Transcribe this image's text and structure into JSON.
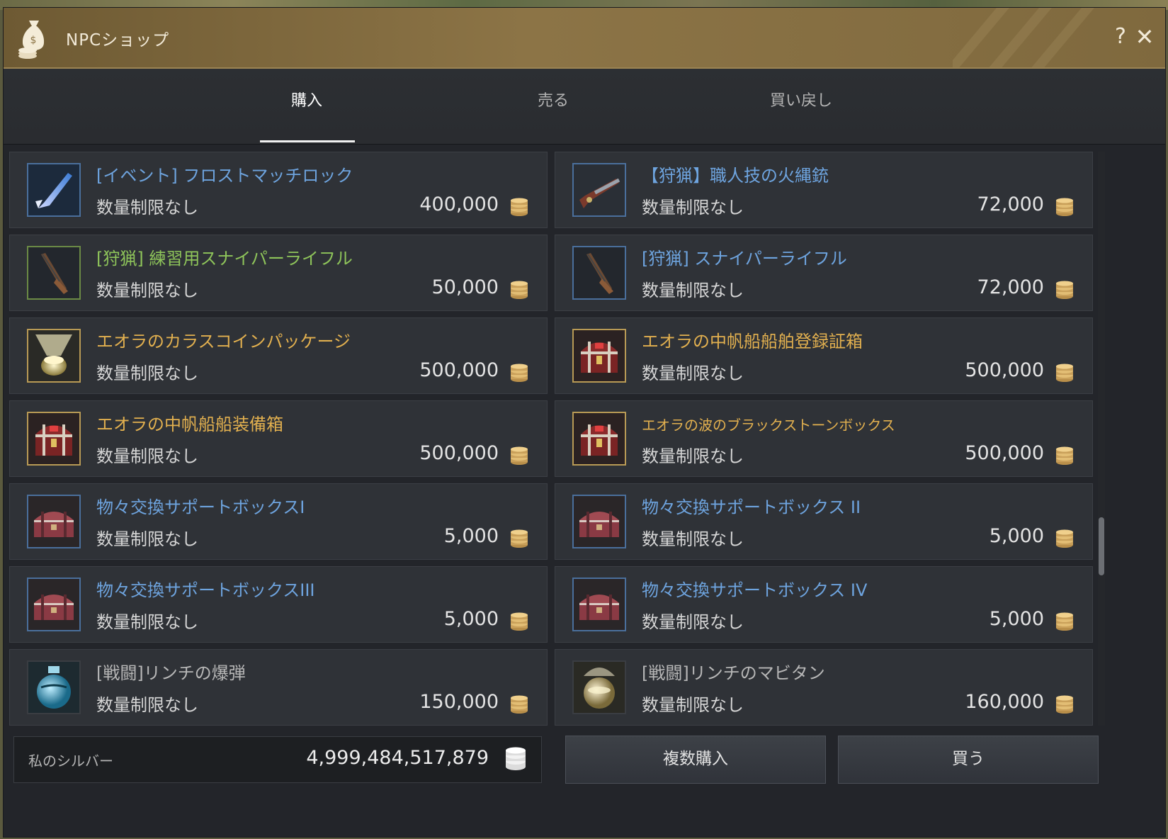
{
  "window": {
    "title": "NPCショップ",
    "help_label": "?",
    "close_label": "✕"
  },
  "tabs": [
    {
      "label": "購入",
      "active": true
    },
    {
      "label": "売る",
      "active": false
    },
    {
      "label": "買い戻し",
      "active": false
    }
  ],
  "items": [
    {
      "name": "[イベント] フロストマッチロック",
      "limit": "数量制限なし",
      "price": "400,000",
      "name_color": "blue",
      "icon": "frost-matchlock-icon"
    },
    {
      "name": "【狩猟】職人技の火縄銃",
      "limit": "数量制限なし",
      "price": "72,000",
      "name_color": "blue",
      "icon": "matchlock-gun-icon"
    },
    {
      "name": "[狩猟] 練習用スナイパーライフル",
      "limit": "数量制限なし",
      "price": "50,000",
      "name_color": "green",
      "icon": "sniper-rifle-icon"
    },
    {
      "name": "[狩猟] スナイパーライフル",
      "limit": "数量制限なし",
      "price": "72,000",
      "name_color": "blue",
      "icon": "sniper-rifle-icon"
    },
    {
      "name": "エオラのカラスコインパッケージ",
      "limit": "数量制限なし",
      "price": "500,000",
      "name_color": "gold",
      "icon": "crow-coin-package-icon"
    },
    {
      "name": "エオラの中帆船船舶登録証箱",
      "limit": "数量制限なし",
      "price": "500,000",
      "name_color": "gold",
      "icon": "treasure-chest-icon"
    },
    {
      "name": "エオラの中帆船船装備箱",
      "limit": "数量制限なし",
      "price": "500,000",
      "name_color": "gold",
      "icon": "treasure-chest-icon"
    },
    {
      "name": "エオラの波のブラックストーンボックス",
      "limit": "数量制限なし",
      "price": "500,000",
      "name_color": "gold",
      "icon": "treasure-chest-icon"
    },
    {
      "name": "物々交換サポートボックスI",
      "limit": "数量制限なし",
      "price": "5,000",
      "name_color": "blue",
      "icon": "support-box-icon"
    },
    {
      "name": "物々交換サポートボックス II",
      "limit": "数量制限なし",
      "price": "5,000",
      "name_color": "blue",
      "icon": "support-box-icon"
    },
    {
      "name": "物々交換サポートボックスIII",
      "limit": "数量制限なし",
      "price": "5,000",
      "name_color": "blue",
      "icon": "support-box-icon"
    },
    {
      "name": "物々交換サポートボックス IV",
      "limit": "数量制限なし",
      "price": "5,000",
      "name_color": "blue",
      "icon": "support-box-icon"
    },
    {
      "name": "[戦闘]リンチの爆弾",
      "limit": "数量制限なし",
      "price": "150,000",
      "name_color": "gray",
      "icon": "bomb-flask-icon"
    },
    {
      "name": "[戦闘]リンチのマビタン",
      "limit": "数量制限なし",
      "price": "160,000",
      "name_color": "gray",
      "icon": "mabitan-flask-icon"
    }
  ],
  "footer": {
    "silver_label": "私のシルバー",
    "silver_value": "4,999,484,517,879",
    "multi_buy_label": "複数購入",
    "buy_label": "買う"
  },
  "colors": {
    "accent": "#8c7446",
    "blue_name": "#6ea4df",
    "green_name": "#8ec45a",
    "gold_name": "#e2b04f",
    "gray_name": "#b7b7b7"
  }
}
